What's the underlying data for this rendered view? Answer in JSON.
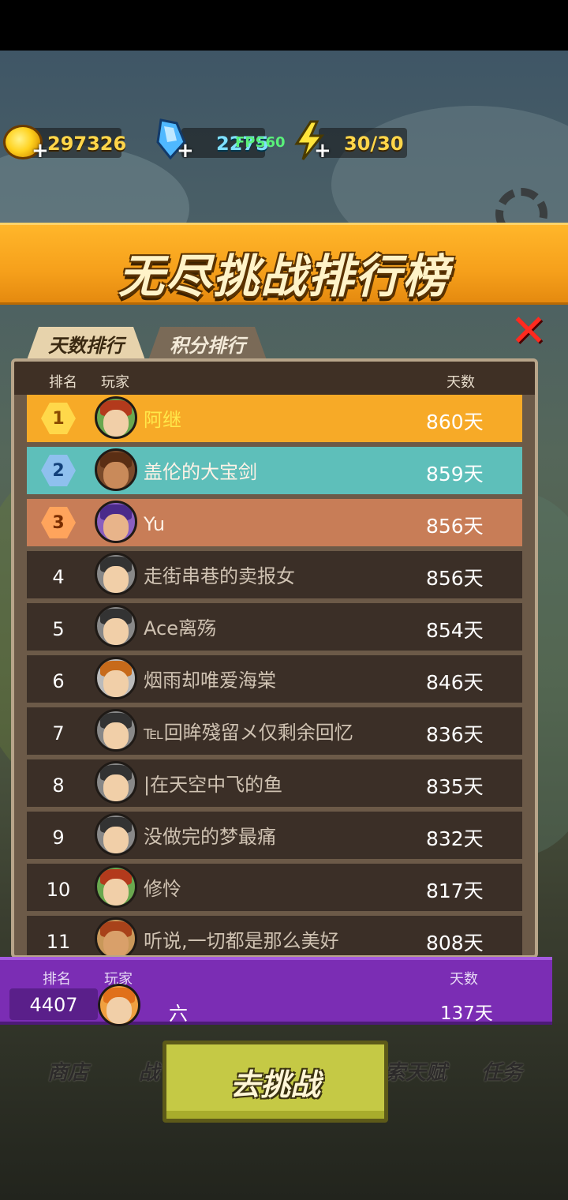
{
  "resources": {
    "gold": "297326",
    "gems": "2275",
    "fps": "FPS60",
    "energy": "30/30"
  },
  "title": "无尽挑战排行榜",
  "tabs": [
    {
      "label": "天数排行",
      "active": true
    },
    {
      "label": "积分排行",
      "active": false
    }
  ],
  "header": {
    "rank": "排名",
    "player": "玩家",
    "days": "天数"
  },
  "leaderboard": [
    {
      "rank": "1",
      "name": "阿继",
      "days": "860天",
      "style": "gold"
    },
    {
      "rank": "2",
      "name": "盖伦的大宝剑",
      "days": "859天",
      "style": "silver"
    },
    {
      "rank": "3",
      "name": "Yu",
      "days": "856天",
      "style": "bronze"
    },
    {
      "rank": "4",
      "name": "走街串巷的卖报女",
      "days": "856天",
      "style": "normal"
    },
    {
      "rank": "5",
      "name": "Ace离殇",
      "days": "854天",
      "style": "normal"
    },
    {
      "rank": "6",
      "name": "烟雨却唯爱海棠",
      "days": "846天",
      "style": "normal"
    },
    {
      "rank": "7",
      "name": "℡回眸殘留メ仅剩余回忆",
      "days": "836天",
      "style": "normal"
    },
    {
      "rank": "8",
      "name": "|在天空中飞的鱼",
      "days": "835天",
      "style": "normal"
    },
    {
      "rank": "9",
      "name": "没做完的梦最痛",
      "days": "832天",
      "style": "normal"
    },
    {
      "rank": "10",
      "name": "修怜",
      "days": "817天",
      "style": "normal"
    },
    {
      "rank": "11",
      "name": "听说,一切都是那么美好",
      "days": "808天",
      "style": "normal"
    }
  ],
  "my_rank": {
    "rank_label": "排名",
    "player_label": "玩家",
    "days_label": "天数",
    "rank": "4407",
    "name": "六",
    "days": "137天"
  },
  "bottom_nav": {
    "shop": "商店",
    "battle": "战",
    "talent": "索天赋",
    "tasks": "任务"
  },
  "challenge_button": "去挑战",
  "colors": {
    "gold_row": "#f7aa27",
    "silver_row": "#5ebfba",
    "bronze_row": "#c87d57",
    "banner": "#f6a01b",
    "my_bar": "#7b2db4",
    "button": "#c5c945"
  }
}
